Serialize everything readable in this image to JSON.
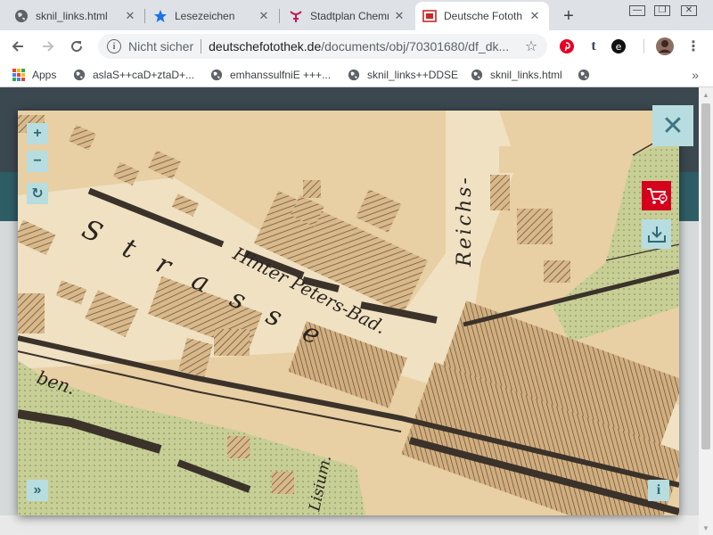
{
  "colors": {
    "tabstrip": "#dee1e6",
    "map_paper": "#e8cfa4",
    "viewer_button": "#b7dde0",
    "cart_button": "#d5001c"
  },
  "tabs": [
    {
      "title": "sknil_links.html",
      "icon": "globe-icon",
      "active": false
    },
    {
      "title": "Lesezeichen",
      "icon": "star-icon",
      "active": false
    },
    {
      "title": "Stadtplan Chemn",
      "icon": "site-logo-icon",
      "active": false
    },
    {
      "title": "Deutsche Fototh",
      "icon": "fotothek-icon",
      "active": true
    }
  ],
  "toolbar": {
    "security_label": "Nicht sicher",
    "url_host": "deutschefotothek.de",
    "url_path": "/documents/obj/70301680/df_dk..."
  },
  "bookmarks": [
    {
      "label": "Apps",
      "icon": "apps-grid-icon"
    },
    {
      "label": "aslaS++caD+ztaD+...",
      "icon": "globe-icon"
    },
    {
      "label": "emhanssulfniE +++...",
      "icon": "globe-icon"
    },
    {
      "label": "sknil_links++DDSE",
      "icon": "globe-icon"
    },
    {
      "label": "sknil_links.html",
      "icon": "globe-icon"
    },
    {
      "label": "",
      "icon": "globe-icon"
    }
  ],
  "viewer": {
    "zoom_in": "+",
    "zoom_out": "−",
    "rotate": "↻",
    "close": "✕",
    "expand": "»",
    "info": "i"
  },
  "map_labels": {
    "strasse": "S t r a s s e",
    "hinter_peters_bad": "Hinter Peters-Bad.",
    "reichs": "Reichs-",
    "ben": "ben.",
    "lisium": "Lisium."
  }
}
